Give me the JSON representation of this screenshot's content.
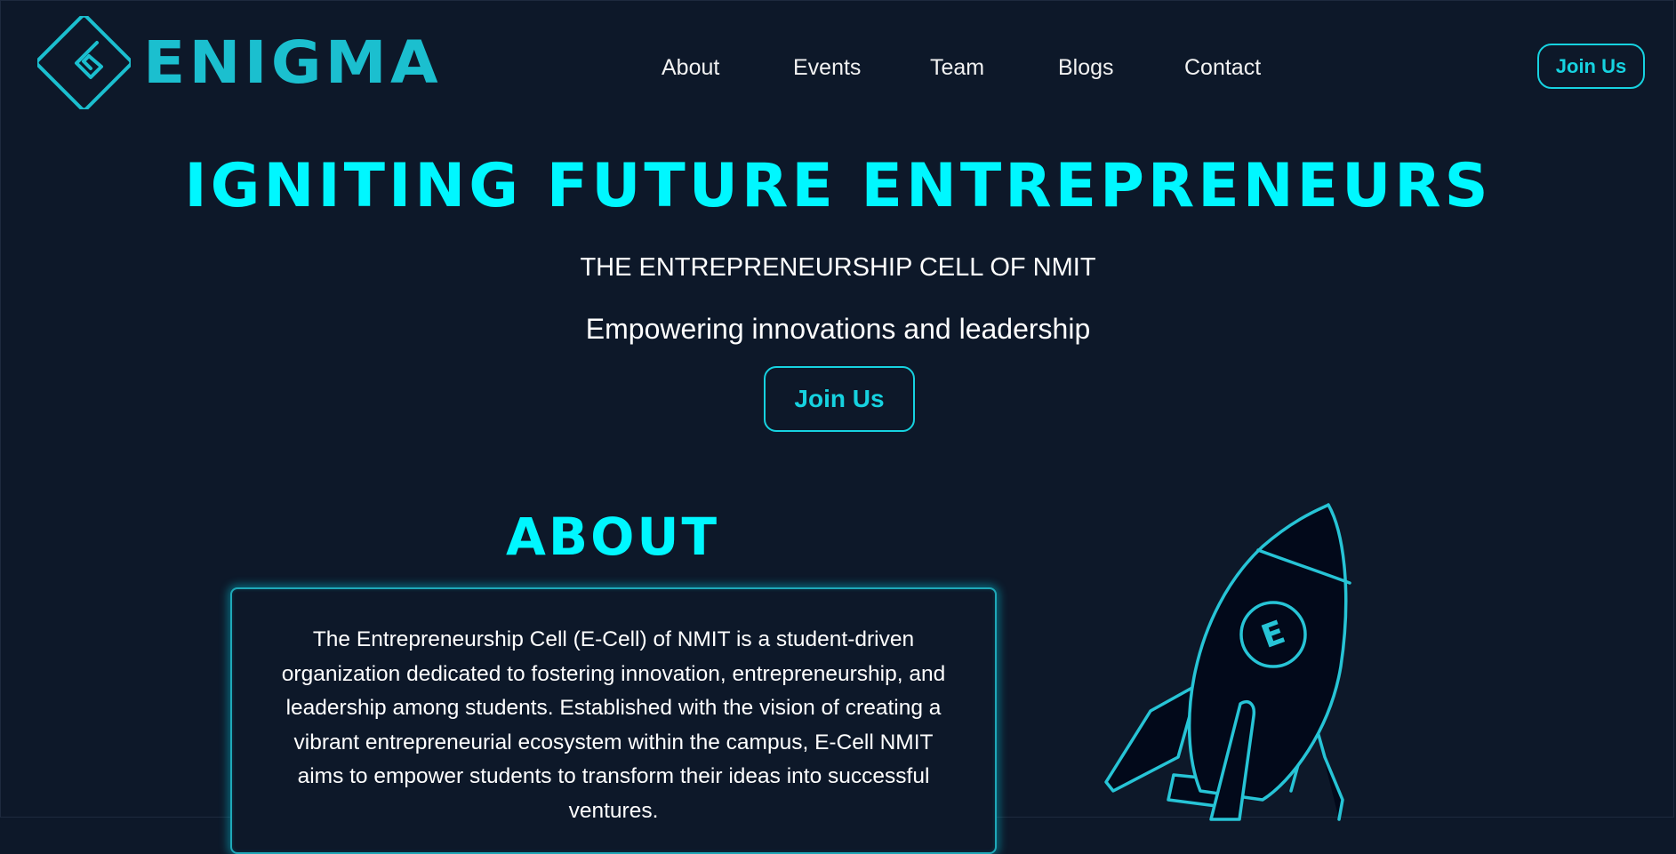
{
  "header": {
    "logo_text": "ENIGMA",
    "nav": [
      {
        "label": "About"
      },
      {
        "label": "Events"
      },
      {
        "label": "Team"
      },
      {
        "label": "Blogs"
      },
      {
        "label": "Contact"
      }
    ],
    "join_label": "Join Us"
  },
  "hero": {
    "title": "IGNITING FUTURE ENTREPRENEURS",
    "subtitle": "THE ENTREPRENEURSHIP CELL OF NMIT",
    "tagline": "Empowering innovations and leadership",
    "join_label": "Join Us"
  },
  "about": {
    "title": "ABOUT",
    "text": "The Entrepreneurship Cell (E-Cell) of NMIT is a student-driven organization dedicated to fostering innovation, entrepreneurship, and leadership among students. Established with the vision of creating a vibrant entrepreneurial ecosystem within the campus, E-Cell NMIT aims to empower students to transform their ideas into successful ventures."
  },
  "illustration": {
    "rocket_emblem": "E"
  },
  "icons": {
    "logo": "enigma-logo-icon",
    "rocket": "rocket-icon"
  },
  "colors": {
    "background": "#0d1829",
    "accent": "#00f7ff",
    "accent_muted": "#1bbfcf",
    "text": "#ffffff"
  }
}
